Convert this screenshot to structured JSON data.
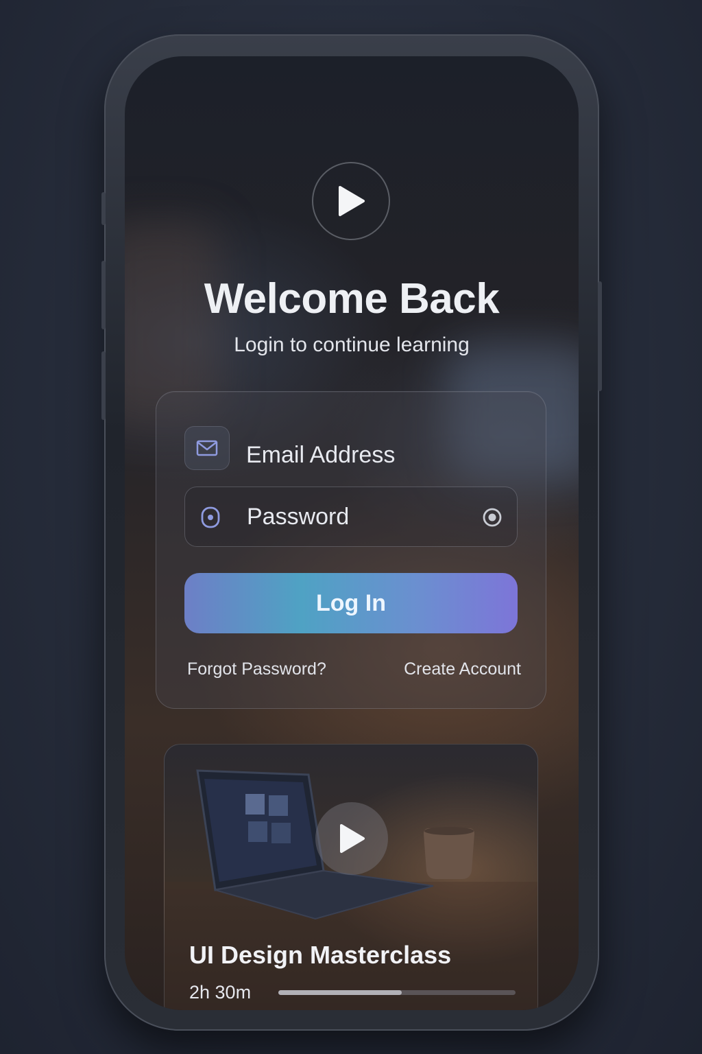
{
  "header": {
    "title": "Welcome Back",
    "subtitle": "Login to continue learning",
    "logo_icon": "play-icon"
  },
  "login_form": {
    "email": {
      "placeholder": "Email Address",
      "icon": "mail-icon"
    },
    "password": {
      "placeholder": "Password",
      "icon": "lock-icon",
      "toggle_icon": "eye-icon"
    },
    "submit_label": "Log In",
    "forgot_label": "Forgot Password?",
    "create_label": "Create Account"
  },
  "featured_course": {
    "title": "UI Design Masterclass",
    "duration": "2h 30m",
    "progress": 0.52,
    "play_icon": "play-icon"
  },
  "colors": {
    "accent_start": "#6d7fc6",
    "accent_mid": "#4fa2c4",
    "accent_end": "#7d75d8",
    "icon_tint": "#8f9be0"
  }
}
